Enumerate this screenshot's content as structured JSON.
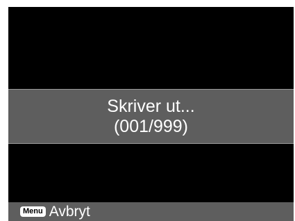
{
  "printing_dialog": {
    "status_text": "Skriver ut...",
    "progress_text": "(001/999)"
  },
  "footer": {
    "menu_key_label": "Menu",
    "cancel_label": "Avbryt"
  },
  "colors": {
    "screen_background": "#000000",
    "panel_background": "#5e5e5e",
    "text": "#ffffff"
  }
}
